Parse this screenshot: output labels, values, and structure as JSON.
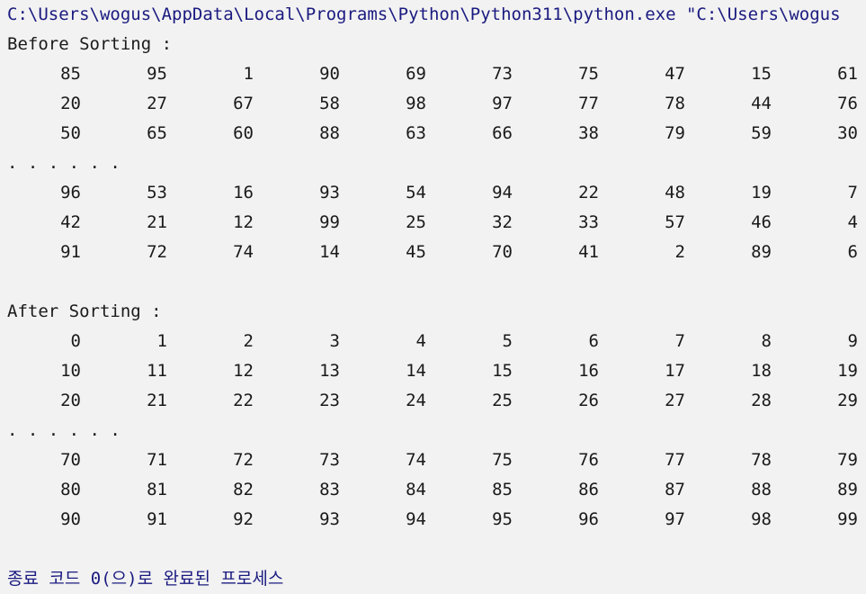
{
  "console": {
    "command": "C:\\Users\\wogus\\AppData\\Local\\Programs\\Python\\Python311\\python.exe \"C:\\Users\\wogus",
    "before_label": "Before Sorting :",
    "after_label": "After Sorting :",
    "ellipsis": ". . . . . .",
    "exit_message": "종료 코드 0(으)로 완료된 프로세스",
    "before_rows": [
      [
        "85",
        "95",
        "1",
        "90",
        "69",
        "73",
        "75",
        "47",
        "15",
        "61"
      ],
      [
        "20",
        "27",
        "67",
        "58",
        "98",
        "97",
        "77",
        "78",
        "44",
        "76"
      ],
      [
        "50",
        "65",
        "60",
        "88",
        "63",
        "66",
        "38",
        "79",
        "59",
        "30"
      ]
    ],
    "before_rows_tail": [
      [
        "96",
        "53",
        "16",
        "93",
        "54",
        "94",
        "22",
        "48",
        "19",
        "7"
      ],
      [
        "42",
        "21",
        "12",
        "99",
        "25",
        "32",
        "33",
        "57",
        "46",
        "4"
      ],
      [
        "91",
        "72",
        "74",
        "14",
        "45",
        "70",
        "41",
        "2",
        "89",
        "6"
      ]
    ],
    "after_rows": [
      [
        "0",
        "1",
        "2",
        "3",
        "4",
        "5",
        "6",
        "7",
        "8",
        "9"
      ],
      [
        "10",
        "11",
        "12",
        "13",
        "14",
        "15",
        "16",
        "17",
        "18",
        "19"
      ],
      [
        "20",
        "21",
        "22",
        "23",
        "24",
        "25",
        "26",
        "27",
        "28",
        "29"
      ]
    ],
    "after_rows_tail": [
      [
        "70",
        "71",
        "72",
        "73",
        "74",
        "75",
        "76",
        "77",
        "78",
        "79"
      ],
      [
        "80",
        "81",
        "82",
        "83",
        "84",
        "85",
        "86",
        "87",
        "88",
        "89"
      ],
      [
        "90",
        "91",
        "92",
        "93",
        "94",
        "95",
        "96",
        "97",
        "98",
        "99"
      ]
    ]
  }
}
